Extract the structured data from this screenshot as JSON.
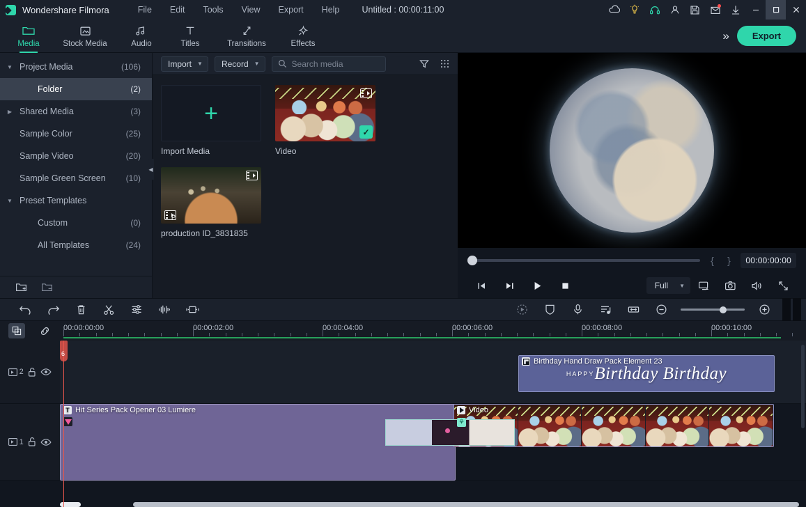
{
  "app": {
    "name": "Wondershare Filmora",
    "project_title": "Untitled : 00:00:11:00"
  },
  "menubar": {
    "items": [
      {
        "label": "File"
      },
      {
        "label": "Edit"
      },
      {
        "label": "Tools"
      },
      {
        "label": "View"
      },
      {
        "label": "Export"
      },
      {
        "label": "Help"
      }
    ]
  },
  "titlebar_icons": [
    {
      "name": "cloud-icon"
    },
    {
      "name": "lightbulb-icon",
      "color": "#e8c24a"
    },
    {
      "name": "headphones-icon",
      "color": "#2fd6ab"
    },
    {
      "name": "account-icon"
    },
    {
      "name": "save-icon"
    },
    {
      "name": "mail-icon",
      "has_notification": true
    },
    {
      "name": "download-icon"
    },
    {
      "name": "minimize-icon"
    },
    {
      "name": "maximize-icon"
    },
    {
      "name": "close-icon"
    }
  ],
  "tabs": {
    "items": [
      {
        "label": "Media",
        "icon": "folder-icon",
        "active": true
      },
      {
        "label": "Stock Media",
        "icon": "stock-media-icon",
        "active": false
      },
      {
        "label": "Audio",
        "icon": "audio-note-icon",
        "active": false
      },
      {
        "label": "Titles",
        "icon": "titles-t-icon",
        "active": false
      },
      {
        "label": "Transitions",
        "icon": "transitions-icon",
        "active": false
      },
      {
        "label": "Effects",
        "icon": "effects-icon",
        "active": false
      }
    ],
    "overflow_label": "»",
    "export_label": "Export"
  },
  "sidebar": {
    "items": [
      {
        "label": "Project Media",
        "count": "(106)",
        "arrow": "▼",
        "selected": false,
        "indent": false
      },
      {
        "label": "Folder",
        "count": "(2)",
        "arrow": "",
        "selected": true,
        "indent": true
      },
      {
        "label": "Shared Media",
        "count": "(3)",
        "arrow": "▶",
        "selected": false,
        "indent": false
      },
      {
        "label": "Sample Color",
        "count": "(25)",
        "arrow": "",
        "selected": false,
        "indent": false
      },
      {
        "label": "Sample Video",
        "count": "(20)",
        "arrow": "",
        "selected": false,
        "indent": false
      },
      {
        "label": "Sample Green Screen",
        "count": "(10)",
        "arrow": "",
        "selected": false,
        "indent": false
      },
      {
        "label": "Preset Templates",
        "count": "",
        "arrow": "▼",
        "selected": false,
        "indent": false
      },
      {
        "label": "Custom",
        "count": "(0)",
        "arrow": "",
        "selected": false,
        "indent": true
      },
      {
        "label": "All Templates",
        "count": "(24)",
        "arrow": "",
        "selected": false,
        "indent": true
      }
    ],
    "footer": [
      {
        "name": "new-folder-icon"
      },
      {
        "name": "remove-folder-icon"
      }
    ]
  },
  "media_toolbar": {
    "import_label": "Import",
    "record_label": "Record",
    "search_placeholder": "Search media",
    "filter_icon": "filter-icon",
    "view_icon": "grid-view-icon"
  },
  "media_items": [
    {
      "label": "Import Media",
      "kind": "import-placeholder"
    },
    {
      "label": "Video",
      "kind": "video",
      "checked": true
    },
    {
      "label": "production ID_3831835",
      "kind": "video",
      "checked": false
    }
  ],
  "preview": {
    "timecode": "00:00:00:00",
    "mark_in": "{",
    "mark_out": "}",
    "quality_label": "Full",
    "controls": [
      {
        "name": "previous-frame-button"
      },
      {
        "name": "next-frame-button"
      },
      {
        "name": "play-button"
      },
      {
        "name": "stop-button"
      }
    ],
    "right_icons": [
      {
        "name": "display-mode-icon"
      },
      {
        "name": "snapshot-camera-icon"
      },
      {
        "name": "volume-icon"
      },
      {
        "name": "fullscreen-icon"
      }
    ]
  },
  "timeline_toolbar": {
    "left_icons": [
      {
        "name": "undo-icon"
      },
      {
        "name": "redo-icon"
      },
      {
        "name": "delete-icon"
      },
      {
        "name": "split-scissors-icon"
      },
      {
        "name": "adjust-sliders-icon"
      },
      {
        "name": "audio-waveform-icon"
      },
      {
        "name": "crop-icon"
      }
    ],
    "right_icons": [
      {
        "name": "auto-highlight-icon"
      },
      {
        "name": "color-match-icon"
      },
      {
        "name": "voiceover-mic-icon"
      },
      {
        "name": "audio-beat-icon"
      },
      {
        "name": "fit-timeline-icon"
      },
      {
        "name": "zoom-out-icon"
      },
      {
        "name": "zoom-in-icon"
      }
    ],
    "zoom_percent": 60
  },
  "timeline": {
    "add_track_icon": "add-track-icon",
    "link_icon": "link-icon",
    "ruler_labels": [
      "00:00:00:00",
      "00:00:02:00",
      "00:00:04:00",
      "00:00:06:00",
      "00:00:08:00",
      "00:00:10:00"
    ],
    "tracks": [
      {
        "number": "2",
        "lock_icon": "unlock-icon",
        "eye_icon": "eye-icon",
        "clips": [
          {
            "name": "Birthday Hand Draw Pack Element 23",
            "art_text": "Birthday Birthday",
            "happy_text": "HAPPY",
            "icon": "pip-icon",
            "color": "#5b6298"
          }
        ]
      },
      {
        "number": "1",
        "lock_icon": "unlock-icon",
        "eye_icon": "eye-icon",
        "clips": [
          {
            "name": "Hit Series Pack Opener 03 Lumiere",
            "icon": "title-t-icon",
            "badge": "gem-icon",
            "color": "#6f6596"
          },
          {
            "name": "Video",
            "icon": "play-icon",
            "badge": "effect-icon",
            "color": "#2a2f3e"
          }
        ]
      }
    ],
    "playhead_position": "00:00:00:00"
  }
}
